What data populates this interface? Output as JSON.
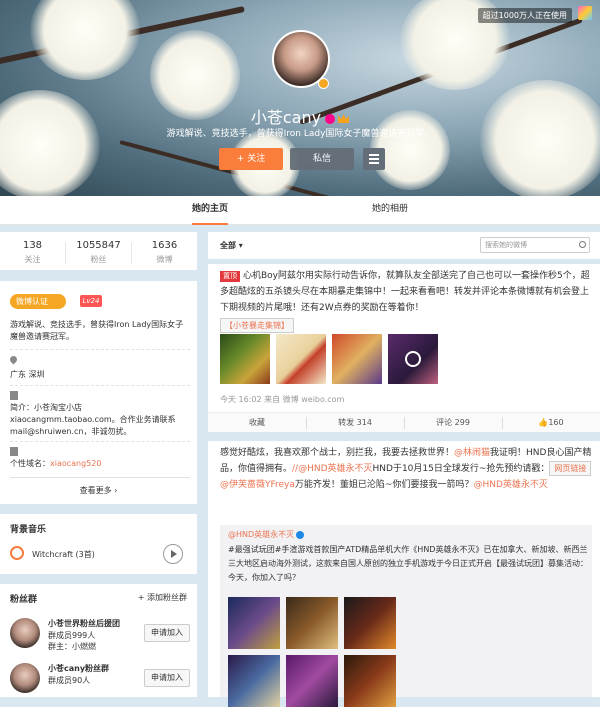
{
  "cover": {
    "usage_badge": "超过1000万人正在使用",
    "name": "小苍cany",
    "intro": "游戏解说、竞技选手，曾获得Iron Lady国际女子魔兽邀请赛冠军。",
    "follow_label": "+ 关注",
    "message_label": "私信"
  },
  "tabs": [
    "她的主页",
    "她的相册"
  ],
  "counts": [
    {
      "num": "138",
      "label": "关注"
    },
    {
      "num": "1055847",
      "label": "粉丝"
    },
    {
      "num": "1636",
      "label": "微博"
    }
  ],
  "about": {
    "badge": "微博认证",
    "level": "Lv24",
    "desc": "游戏解说、竞技选手，曾获得Iron Lady国际女子魔兽邀请赛冠军。",
    "location": "广东 深圳",
    "profile_line1": "简介：小苍淘宝小店",
    "profile_line2": "xiaocangmm.taobao.com。合作业务请联系",
    "profile_line3": "mail@shruiwen.cn，非诚勿扰。",
    "domain_label": "个性域名：",
    "domain_value": "xiaocang520",
    "see_more": "查看更多 ›"
  },
  "music": {
    "title": "背景音乐",
    "track": "Witchcraft (3首)"
  },
  "fans": {
    "title": "粉丝群",
    "add": "+ 添加粉丝群",
    "groups": [
      {
        "name": "小苍世界粉丝后援团",
        "members": "群成员999人",
        "owner": "群主：小燃燃",
        "join": "申请加入"
      },
      {
        "name": "小苍cany粉丝群",
        "members": "群成员90人",
        "owner": "",
        "join": "申请加入"
      }
    ]
  },
  "feed": {
    "filter": "全部 ▾",
    "search_placeholder": "搜索她的微博"
  },
  "post1": {
    "hot": "置顶",
    "text": "心机Boy阿兹尔用实际行动告诉你，就算队友全部送完了自己也可以一套操作秒5个，超多超酷炫的五杀镜头尽在本期暴走集锦中！一起来看看吧",
    "text2": "！转发并评论本条微博就有机会登上下期视频的片尾哦！还有2W点券的奖励在等着你！",
    "video_link": "【小苍暴走集锦】",
    "meta": "今天 16:02 来自 微博 weibo.com",
    "actions": [
      "收藏",
      "转发 314",
      "评论 299",
      "160"
    ]
  },
  "post2": {
    "text_a": "感觉好酷炫，我喜欢那个战士，别拦我，我要去拯救世界！",
    "mention1": "@林闹猫",
    "text_b": "我证明！HND良心国产精品，你值得拥有。",
    "mention2": "//@HND英雄永不灭",
    "text_c": "HND于10月15日全球发行~抢先预约请戳：",
    "web_link": "网页链接",
    "mention3": "@伊芙蔷薇YFreya",
    "text_d": "万能齐发！董姐已沦陷~你们要接我一箭吗？",
    "mention4": "@HND英雄永不灭",
    "repost_name": "@HND英雄永不灭",
    "repost_text": "#最强试玩团#手渲游戏首款国产ATD精品单机大作《HND英雄永不灭》已在加拿大、新加坡、新西兰三大地区启动海外测试，这款来自国人原创的独立手机游戏于今日正式开启【最强试玩团】募集活动：今天，你加入了吗？"
  }
}
